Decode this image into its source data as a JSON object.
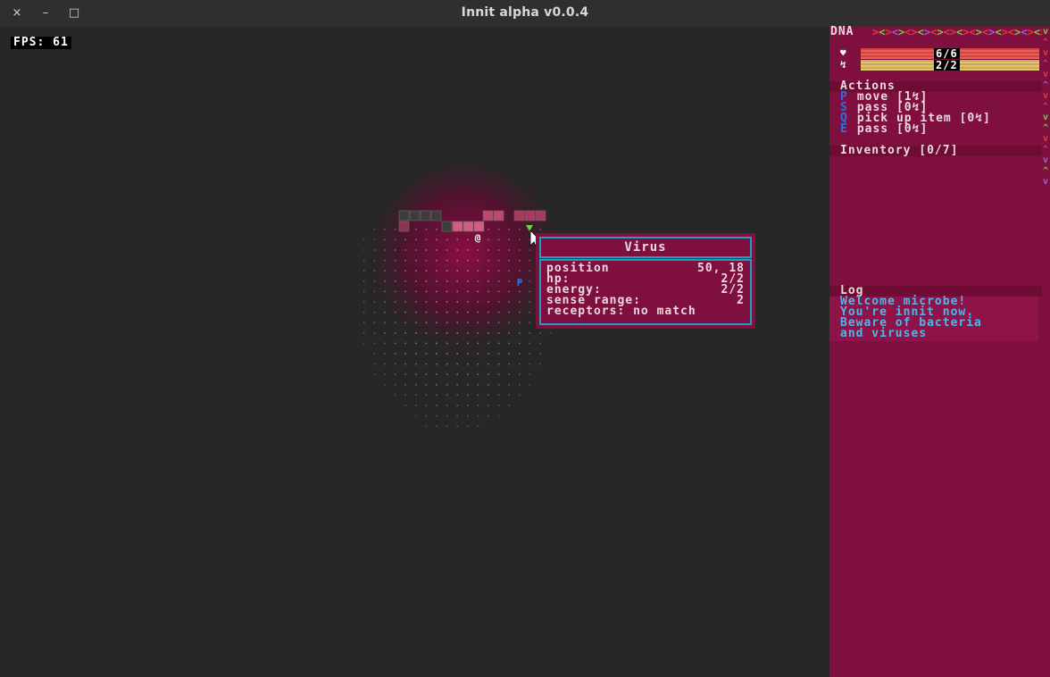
{
  "window": {
    "title": "Innit alpha v0.0.4",
    "close_icon": "×",
    "minimize_icon": "–",
    "maximize_icon": "□"
  },
  "fps": {
    "label": "FPS: 61"
  },
  "map": {
    "player_glyph": "@",
    "enemy_glyph": "P",
    "cursor_icon": "mouse-pointer-icon"
  },
  "tooltip": {
    "title": "Virus",
    "rows": [
      {
        "label": "position",
        "value": "50, 18"
      },
      {
        "label": "hp:",
        "value": "2/2"
      },
      {
        "label": "energy:",
        "value": "2/2"
      },
      {
        "label": "sense range:",
        "value": "2"
      },
      {
        "label": "receptors: no match",
        "value": ""
      }
    ]
  },
  "sidebar": {
    "dna_label": "DNA",
    "dna_strip": ">< ><>< ><>< >< >< >< ><",
    "hp": {
      "icon": "♥",
      "value": "6/6"
    },
    "energy": {
      "icon": "↯",
      "value": "2/2"
    },
    "actions": {
      "header": "Actions",
      "items": [
        {
          "key": "P",
          "label": "move [1↯]"
        },
        {
          "key": "S",
          "label": "pass [0↯]"
        },
        {
          "key": "Q",
          "label": "pick up item [0↯]"
        },
        {
          "key": "E",
          "label": "pass [0↯]"
        }
      ]
    },
    "inventory": {
      "header": "Inventory [0/7]"
    },
    "log": {
      "header": "Log",
      "lines": [
        "Welcome microbe!",
        "You're innit now.",
        "Beware of bacteria",
        "and viruses"
      ]
    }
  },
  "colors": {
    "background": "#272727",
    "panel": "#7f0f3f",
    "accent_cyan": "#1f9fbf",
    "log_text": "#4fb7ea",
    "key_text": "#2c6fe0",
    "enemy": "#2c6fe0",
    "virus": "#6fd24a"
  }
}
